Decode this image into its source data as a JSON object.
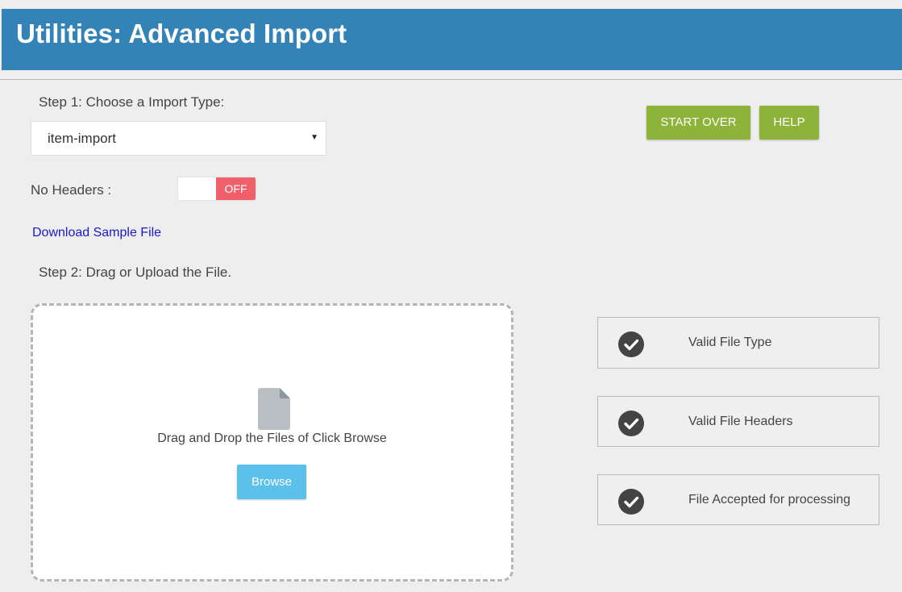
{
  "header": {
    "title": "Utilities: Advanced Import"
  },
  "step1": {
    "label": "Step 1: Choose a Import Type:",
    "import_type_value": "item-import"
  },
  "toggle": {
    "label": "No Headers :",
    "state": "OFF"
  },
  "links": {
    "download_sample": "Download Sample File"
  },
  "step2": {
    "label": "Step 2: Drag or Upload the File."
  },
  "dropzone": {
    "text": "Drag and Drop the Files of Click Browse",
    "browse_label": "Browse"
  },
  "actions": {
    "start_over": "START OVER",
    "help": "HELP"
  },
  "status": [
    {
      "label": "Valid File Type",
      "icon": "check-circle-icon"
    },
    {
      "label": "Valid File Headers",
      "icon": "check-circle-icon"
    },
    {
      "label": "File Accepted for processing",
      "icon": "check-circle-icon"
    }
  ],
  "colors": {
    "header_bg": "#3383b6",
    "green_button": "#8db33a",
    "toggle_off": "#f0606a",
    "browse_button": "#5bc0ea",
    "link": "#1a1acc"
  }
}
